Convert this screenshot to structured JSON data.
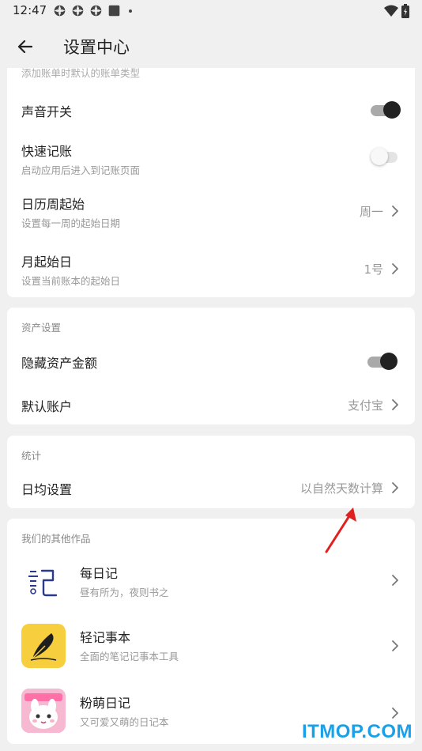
{
  "status_bar": {
    "time": "12:47",
    "left_icons": [
      "gear-icon",
      "gear-icon",
      "gear-icon",
      "square-icon"
    ],
    "right_icons": [
      "wifi-icon",
      "battery-icon"
    ]
  },
  "toolbar": {
    "title": "设置中心"
  },
  "ledger_section": {
    "truncated_sub": "添加账单时默认的账单类型",
    "sound": {
      "title": "声音开关",
      "enabled": true
    },
    "quick_record": {
      "title": "快速记账",
      "subtitle": "启动应用后进入到记账页面",
      "enabled": false
    },
    "week_start": {
      "title": "日历周起始",
      "subtitle": "设置每一周的起始日期",
      "value": "周一"
    },
    "month_start": {
      "title": "月起始日",
      "subtitle": "设置当前账本的起始日",
      "value": "1号"
    }
  },
  "asset_section": {
    "label": "资产设置",
    "hide_amount": {
      "title": "隐藏资产金额",
      "enabled": true
    },
    "default_account": {
      "title": "默认账户",
      "value": "支付宝"
    }
  },
  "stats_section": {
    "label": "统计",
    "daily_avg": {
      "title": "日均设置",
      "value": "以自然天数计算"
    }
  },
  "apps_section": {
    "label": "我们的其他作品",
    "apps": [
      {
        "title": "每日记",
        "subtitle": "昼有所为，夜则书之",
        "icon": "diary-ji-icon"
      },
      {
        "title": "轻记事本",
        "subtitle": "全面的笔记记事本工具",
        "icon": "feather-icon"
      },
      {
        "title": "粉萌日记",
        "subtitle": "又可爱又萌的日记本",
        "icon": "cute-rabbit-icon"
      }
    ]
  },
  "watermark": "ITMOP.COM",
  "colors": {
    "background": "#f0f0f0",
    "card": "#ffffff",
    "toggle_on_knob": "#222222",
    "annotation_arrow": "#e02020",
    "watermark": "#1aa0e8",
    "feather_icon_bg": "#f7cf3e"
  }
}
